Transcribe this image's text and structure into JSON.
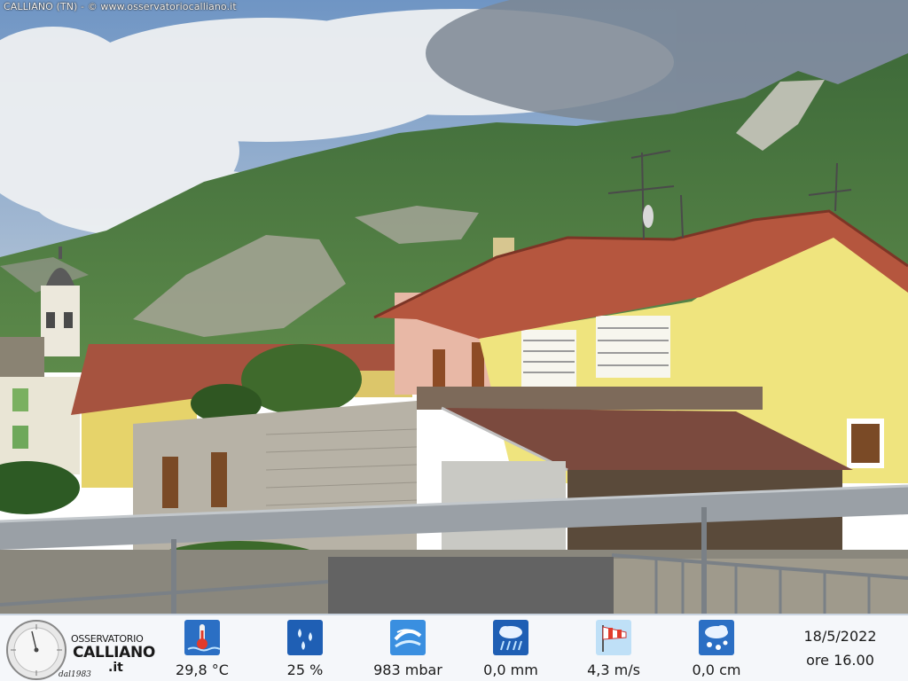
{
  "caption": "CALLIANO (TN) - © www.osservatoriocalliano.it",
  "logo": {
    "line1": "OSSERVATORIO",
    "line2": "CALLIANO",
    "line3": ".it",
    "since": "dal1983"
  },
  "readings": [
    {
      "icon": "thermometer-icon",
      "value": "29,8 °C"
    },
    {
      "icon": "humidity-drops-icon",
      "value": "25 %"
    },
    {
      "icon": "pressure-icon",
      "value": "983 mbar"
    },
    {
      "icon": "rain-cloud-icon",
      "value": "0,0 mm"
    },
    {
      "icon": "windsock-icon",
      "value": "4,3 m/s"
    },
    {
      "icon": "snow-cloud-icon",
      "value": "0,0 cm"
    }
  ],
  "datetime": {
    "date": "18/5/2022",
    "time": "ore 16.00"
  },
  "colors": {
    "icon_blue": "#2b6fc4",
    "roof": "#b5563e",
    "wall_yellow": "#ece27a"
  }
}
